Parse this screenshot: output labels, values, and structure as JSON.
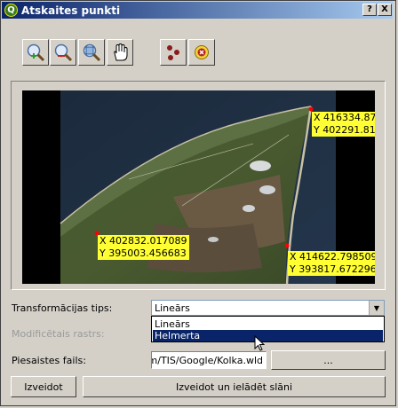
{
  "window": {
    "title": "Atskaites punkti"
  },
  "titlebar_buttons": {
    "help": "?",
    "close": "X"
  },
  "toolbar": {
    "zoom_in_icon": "zoom-in-icon",
    "zoom_out_icon": "zoom-out-icon",
    "zoom_full_icon": "zoom-full-icon",
    "pan_icon": "pan-hand-icon",
    "add_point_icon": "add-points-icon",
    "delete_point_icon": "delete-point-icon"
  },
  "map": {
    "points": [
      {
        "x": "X 416334.87",
        "y": "Y 402291.81"
      },
      {
        "x": "X 402832.017089",
        "y": "Y 395003.456683"
      },
      {
        "x": "X 414622.798509",
        "y": "Y 393817.672296"
      }
    ]
  },
  "form": {
    "transform_label": "Transformācijas tips:",
    "transform_value": "Lineārs",
    "transform_options": [
      "Lineārs",
      "Helmerta"
    ],
    "selected_option_index": 1,
    "modified_raster_label": "Modificētais rastrs:",
    "link_file_label": "Piesaistes fails:",
    "link_file_value": "oam/TIS/Google/Kolka.wld",
    "browse_label": "..."
  },
  "buttons": {
    "create": "Izveidot",
    "create_load": "Izveidot un ielādēt slāni"
  }
}
